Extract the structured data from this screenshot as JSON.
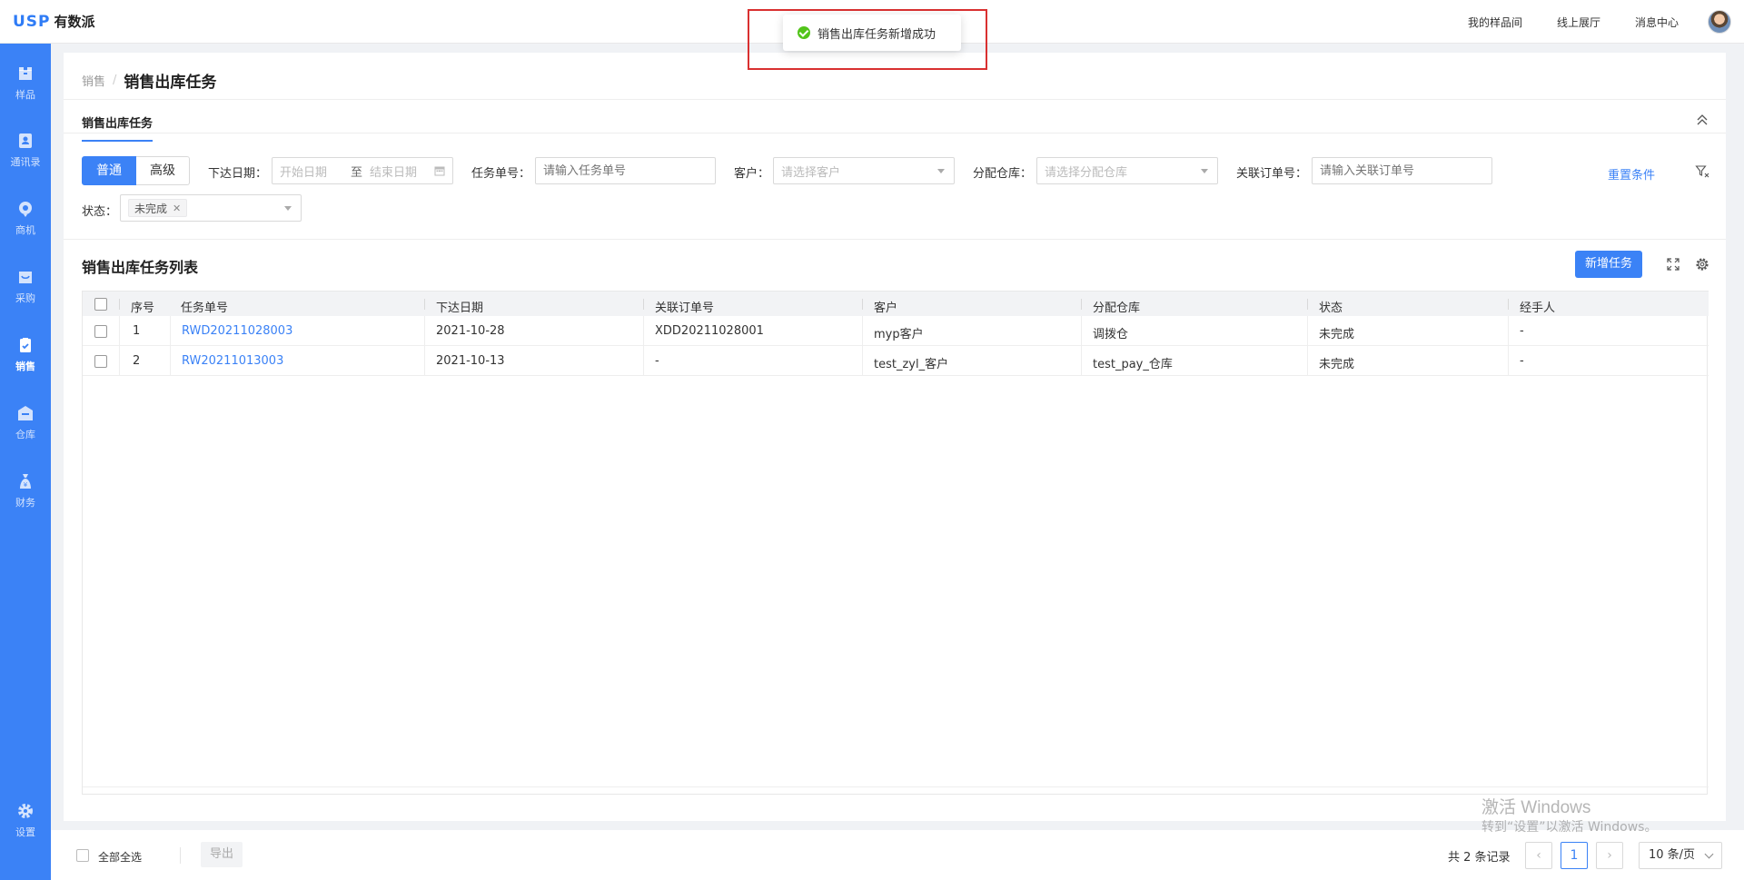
{
  "app": {
    "logo_mark": "USP",
    "logo_text": "有数派"
  },
  "top_nav": [
    "我的样品间",
    "线上展厅",
    "消息中心"
  ],
  "sidebar": {
    "items": [
      {
        "label": "样品",
        "icon": "box-icon"
      },
      {
        "label": "通讯录",
        "icon": "contact-icon"
      },
      {
        "label": "商机",
        "icon": "opportunity-icon"
      },
      {
        "label": "采购",
        "icon": "purchase-icon"
      },
      {
        "label": "销售",
        "icon": "sales-icon",
        "active": true
      },
      {
        "label": "仓库",
        "icon": "warehouse-icon"
      },
      {
        "label": "财务",
        "icon": "finance-icon"
      }
    ],
    "settings_label": "设置"
  },
  "breadcrumb": {
    "parent": "销售",
    "current": "销售出库任务"
  },
  "subtab": "销售出库任务",
  "filters": {
    "mode_buttons": [
      "普通",
      "高级"
    ],
    "issue_date_label": "下达日期",
    "start_date_placeholder": "开始日期",
    "to_label": "至",
    "end_date_placeholder": "结束日期",
    "task_no_label": "任务单号",
    "task_no_placeholder": "请输入任务单号",
    "customer_label": "客户",
    "customer_placeholder": "请选择客户",
    "warehouse_label": "分配仓库",
    "warehouse_placeholder": "请选择分配仓库",
    "order_no_label": "关联订单号",
    "order_no_placeholder": "请输入关联订单号",
    "reset_label": "重置条件",
    "status_label": "状态",
    "status_tag": "未完成"
  },
  "list": {
    "title": "销售出库任务列表",
    "add_button": "新增任务",
    "columns": [
      "序号",
      "任务单号",
      "下达日期",
      "关联订单号",
      "客户",
      "分配仓库",
      "状态",
      "经手人"
    ],
    "rows": [
      {
        "no": "1",
        "task_no": "RWD20211028003",
        "date": "2021-10-28",
        "order_no": "XDD20211028001",
        "customer": "myp客户",
        "warehouse": "调拨仓",
        "status": "未完成",
        "handler": "-"
      },
      {
        "no": "2",
        "task_no": "RW20211013003",
        "date": "2021-10-13",
        "order_no": "-",
        "customer": "test_zyl_客户",
        "warehouse": "test_pay_仓库",
        "status": "未完成",
        "handler": "-"
      }
    ]
  },
  "footer": {
    "select_all": "全部全选",
    "export": "导出",
    "total": "共 2 条记录",
    "page": "1",
    "page_size": "10 条/页"
  },
  "toast": {
    "message": "销售出库任务新增成功"
  },
  "watermark": {
    "line1": "激活 Windows",
    "line2": "转到“设置”以激活 Windows。"
  },
  "colors": {
    "primary": "#3b82f6",
    "success": "#52c41a",
    "highlight": "#d93030"
  }
}
